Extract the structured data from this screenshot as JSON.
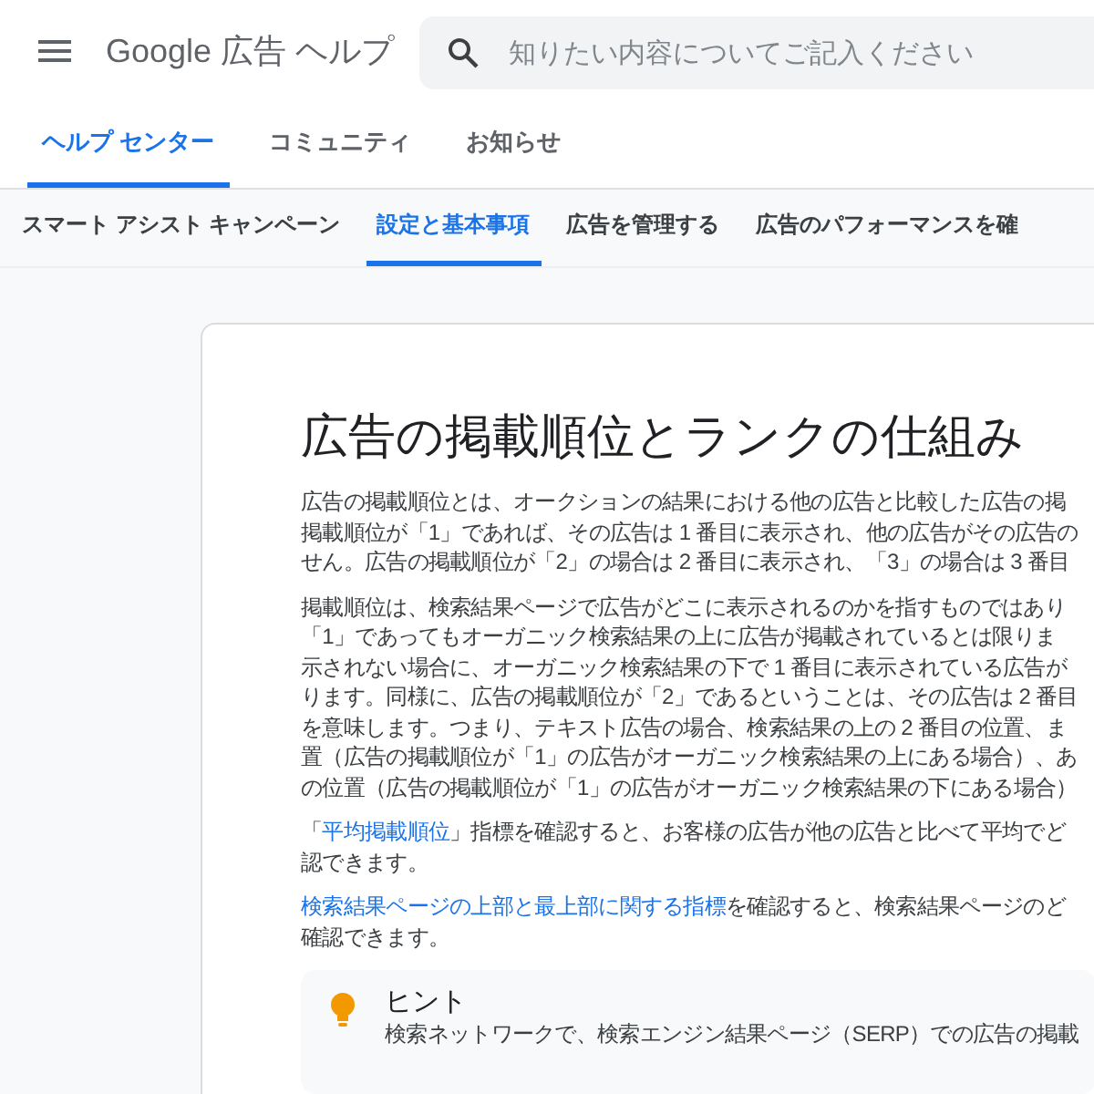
{
  "header": {
    "title": "Google 広告 ヘルプ",
    "search": {
      "placeholder": "知りたい内容についてご記入ください"
    }
  },
  "tabs": [
    {
      "label": "ヘルプ センター",
      "selected": true
    },
    {
      "label": "コミュニティ",
      "selected": false
    },
    {
      "label": "お知らせ",
      "selected": false
    }
  ],
  "subnav": [
    {
      "label": "スマート アシスト キャンペーン",
      "selected": false
    },
    {
      "label": "設定と基本事項",
      "selected": true
    },
    {
      "label": "広告を管理する",
      "selected": false
    },
    {
      "label": "広告のパフォーマンスを確",
      "selected": false
    }
  ],
  "article": {
    "title": "広告の掲載順位とランクの仕組み",
    "paragraphs": [
      {
        "lines": [
          [
            {
              "text": "広告の掲載順位とは、オークションの結果における他の広告と比較した広告の掲"
            }
          ],
          [
            {
              "text": "掲載順位が「1」であれば、その広告は 1 番目に表示され、他の広告がその広告の"
            }
          ],
          [
            {
              "text": "せん。広告の掲載順位が「2」の場合は 2 番目に表示され、「3」の場合は 3 番目"
            }
          ]
        ]
      },
      {
        "lines": [
          [
            {
              "text": "掲載順位は、検索結果ページで広告がどこに表示されるのかを指すものではあり"
            }
          ],
          [
            {
              "text": "「1」であってもオーガニック検索結果の上に広告が掲載されているとは限りま"
            }
          ],
          [
            {
              "text": "示されない場合に、オーガニック検索結果の下で 1 番目に表示されている広告が"
            }
          ],
          [
            {
              "text": "ります。同様に、広告の掲載順位が「2」であるということは、その広告は 2 番目"
            }
          ],
          [
            {
              "text": "を意味します。つまり、テキスト広告の場合、検索結果の上の 2 番目の位置、ま"
            }
          ],
          [
            {
              "text": "置（広告の掲載順位が「1」の広告がオーガニック検索結果の上にある場合）、あ"
            }
          ],
          [
            {
              "text": "の位置（広告の掲載順位が「1」の広告がオーガニック検索結果の下にある場合）"
            }
          ]
        ]
      },
      {
        "lines": [
          [
            {
              "text": "「"
            },
            {
              "text": "平均掲載順位",
              "link": true
            },
            {
              "text": "」指標を確認すると、お客様の広告が他の広告と比べて平均でど"
            }
          ],
          [
            {
              "text": "認できます。"
            }
          ]
        ]
      },
      {
        "lines": [
          [
            {
              "text": "検索結果ページの上部と最上部に関する指標",
              "link": true
            },
            {
              "text": "を確認すると、検索結果ページのど"
            }
          ],
          [
            {
              "text": "確認できます。"
            }
          ]
        ]
      }
    ],
    "hint": {
      "title": "ヒント",
      "text": "検索ネットワークで、検索エンジン結果ページ（SERP）での広告の掲載"
    }
  }
}
